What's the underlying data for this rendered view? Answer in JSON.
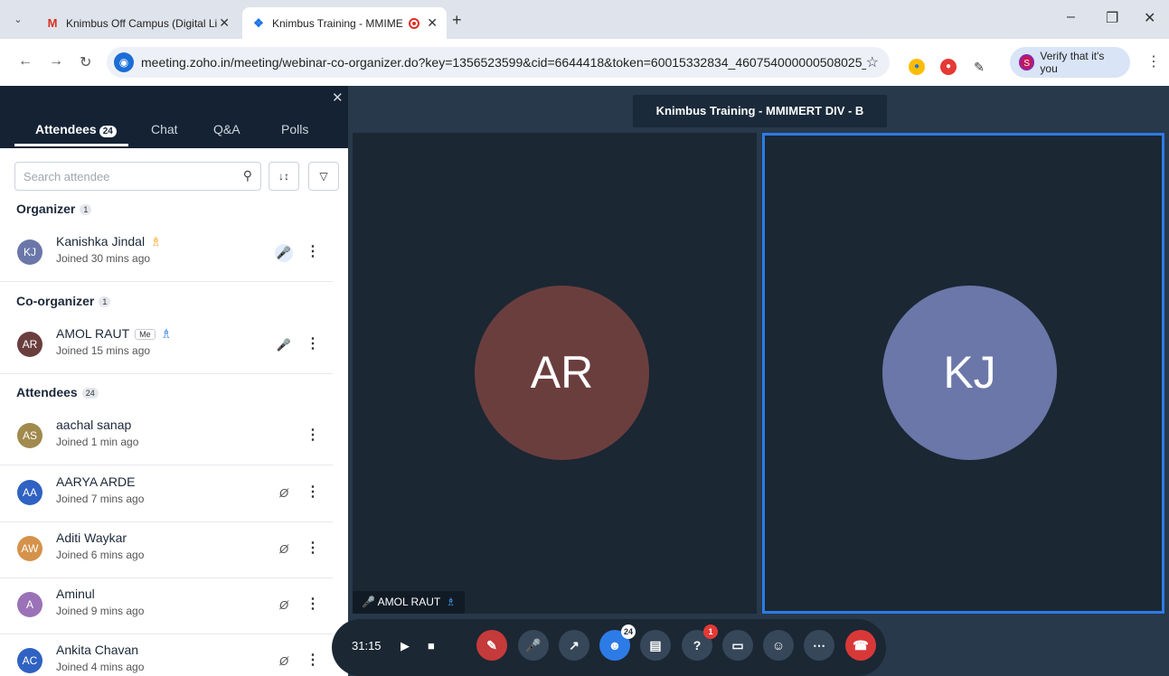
{
  "browser": {
    "tabs": [
      {
        "title": "Knimbus Off Campus (Digital Li",
        "favicon": "M",
        "favicon_color": "#d93025"
      },
      {
        "title": "Knimbus Training - MMIME",
        "favicon": "Z",
        "favicon_color": "#1a73e8",
        "recording": true
      }
    ],
    "new_tab_glyph": "+",
    "url": "meeting.zoho.in/meeting/webinar-co-organizer.do?key=1356523599&cid=6644418&token=60015332834_460754000000508025_tok...",
    "verify_label": "Verify that it's you",
    "profile_initial": "S"
  },
  "sidebar": {
    "tabs": [
      {
        "label": "Attendees",
        "count": "24"
      },
      {
        "label": "Chat"
      },
      {
        "label": "Q&A"
      },
      {
        "label": "Polls"
      }
    ],
    "search_placeholder": "Search attendee",
    "sections": {
      "organizer": {
        "label": "Organizer",
        "count": "1"
      },
      "coorganizer": {
        "label": "Co-organizer",
        "count": "1"
      },
      "attendees": {
        "label": "Attendees",
        "count": "24"
      }
    },
    "organizer": {
      "initials": "KJ",
      "name": "Kanishka Jindal",
      "joined": "Joined 30 mins ago",
      "color": "#6b77a8"
    },
    "coorganizer": {
      "initials": "AR",
      "name": "AMOL RAUT",
      "me": "Me",
      "joined": "Joined 15 mins ago",
      "color": "#6b3e3e"
    },
    "attendees": [
      {
        "initials": "AS",
        "name": "aachal sanap",
        "joined": "Joined 1 min ago",
        "color": "#a08a4e"
      },
      {
        "initials": "AA",
        "name": "AARYA ARDE",
        "joined": "Joined 7 mins ago",
        "color": "#2f62c2"
      },
      {
        "initials": "AW",
        "name": "Aditi Waykar",
        "joined": "Joined 6 mins ago",
        "color": "#d4924a"
      },
      {
        "initials": "A",
        "name": "Aminul",
        "joined": "Joined 9 mins ago",
        "color": "#9b72b8"
      },
      {
        "initials": "AC",
        "name": "Ankita Chavan",
        "joined": "Joined 4 mins ago",
        "color": "#2f62c2"
      }
    ]
  },
  "meeting": {
    "title": "Knimbus Training - MMIMERT DIV - B",
    "tiles": [
      {
        "initials": "AR",
        "color": "#6b3e3e"
      },
      {
        "initials": "KJ",
        "color": "#6b77a8"
      }
    ],
    "name_tag": "AMOL RAUT"
  },
  "controls": {
    "timer": "31:15",
    "participants_badge": "24",
    "qa_badge": "1"
  }
}
